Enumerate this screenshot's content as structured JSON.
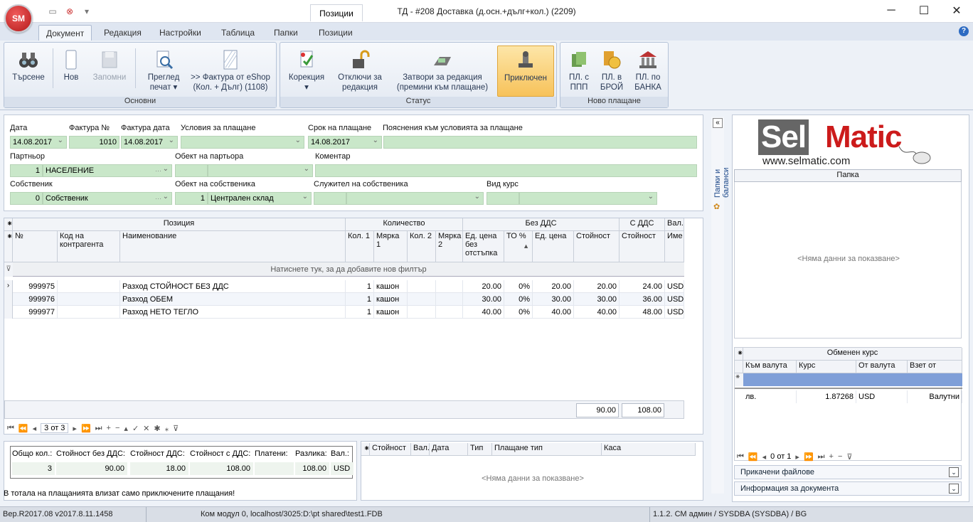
{
  "app": {
    "logo": "SM",
    "window_title": "ТД - #208 Доставка (д.осн.+дълг+кол.) (2209)",
    "context_tab": "Позиции"
  },
  "tabs": [
    "Документ",
    "Редакция",
    "Настройки",
    "Таблица",
    "Папки",
    "Позиции"
  ],
  "ribbon": {
    "groups": [
      {
        "caption": "Основни"
      },
      {
        "caption": "Статус"
      },
      {
        "caption": "Ново плащане"
      }
    ],
    "buttons": [
      {
        "l1": "Търсене",
        "l2": "",
        "icon": "binoculars-icon"
      },
      {
        "l1": "Нов",
        "l2": "",
        "icon": "new-document-icon"
      },
      {
        "l1": "Запомни",
        "l2": "",
        "icon": "save-icon"
      },
      {
        "l1": "Преглед",
        "l2": "печат ▾",
        "icon": "print-preview-icon"
      },
      {
        "l1": ">> Фактура от eShop",
        "l2": "(Кол. + Дълг) (1108)",
        "icon": "invoice-icon"
      },
      {
        "l1": "Корекция",
        "l2": "▾",
        "icon": "correction-icon"
      },
      {
        "l1": "Отключи за",
        "l2": "редакция",
        "icon": "unlock-icon"
      },
      {
        "l1": "Затвори за редакция",
        "l2": "(премини към плащане)",
        "icon": "cash-register-icon"
      },
      {
        "l1": "Приключен",
        "l2": "",
        "icon": "stamp-icon"
      },
      {
        "l1": "ПЛ. с",
        "l2": "ППП",
        "icon": "money-icon"
      },
      {
        "l1": "ПЛ. в",
        "l2": "БРОЙ",
        "icon": "coins-icon"
      },
      {
        "l1": "ПЛ. по",
        "l2": "БАНКА",
        "icon": "bank-icon"
      }
    ]
  },
  "form": {
    "labels": {
      "date": "Дата",
      "invoice_no": "Фактура №",
      "invoice_date": "Фактура дата",
      "pay_terms": "Условия за плащане",
      "due": "Срок на плащане",
      "terms_note": "Пояснения към условията за плащане",
      "partner": "Партньор",
      "partner_obj": "Обект на партьора",
      "comment": "Коментар",
      "owner": "Собственик",
      "owner_obj": "Обект на собственика",
      "employee": "Служител на собственика",
      "rate_type": "Вид курс"
    },
    "values": {
      "date": "14.08.2017",
      "invoice_no": "1010",
      "invoice_date": "14.08.2017",
      "due": "14.08.2017",
      "partner_code": "1",
      "partner_name": "НАСЕЛЕНИЕ",
      "owner_code": "0",
      "owner_name": "Собственик",
      "owner_obj_code": "1",
      "owner_obj_name": "Централен склад"
    }
  },
  "grid": {
    "bands": [
      "Позиция",
      "Количество",
      "Без ДДС",
      "С ДДС",
      "Вал."
    ],
    "columns": [
      "№",
      "Код на контрагента",
      "Наименование",
      "Кол. 1",
      "Мярка 1",
      "Кол. 2",
      "Мярка 2",
      "Ед. цена без отстъпка",
      "ТО %",
      "Ед. цена",
      "Стойност",
      "Стойност",
      "Име"
    ],
    "filter_hint": "Натиснете тук, за да добавите нов филтър",
    "rows": [
      {
        "no": "999975",
        "code": "",
        "name": "Разход СТОЙНОСТ БЕЗ ДДС",
        "q1": "1",
        "m1": "кашон",
        "q2": "",
        "m2": "",
        "price0": "20.00",
        "disc": "0%",
        "price": "20.00",
        "value": "20.00",
        "vat_value": "24.00",
        "cur": "USD"
      },
      {
        "no": "999976",
        "code": "",
        "name": "Разход ОБЕМ",
        "q1": "1",
        "m1": "кашон",
        "q2": "",
        "m2": "",
        "price0": "30.00",
        "disc": "0%",
        "price": "30.00",
        "value": "30.00",
        "vat_value": "36.00",
        "cur": "USD"
      },
      {
        "no": "999977",
        "code": "",
        "name": "Разход НЕТО ТЕГЛО",
        "q1": "1",
        "m1": "кашон",
        "q2": "",
        "m2": "",
        "price0": "40.00",
        "disc": "0%",
        "price": "40.00",
        "value": "40.00",
        "vat_value": "48.00",
        "cur": "USD"
      }
    ],
    "footer": {
      "value_total": "90.00",
      "vat_total": "108.00"
    },
    "nav": {
      "pos": "3 от 3"
    }
  },
  "totals": {
    "headers": [
      "Общо кол.:",
      "Стойност без ДДС:",
      "Стойност ДДС:",
      "Стойност с ДДС:",
      "Платени:",
      "Разлика:",
      "Вал.:"
    ],
    "values": [
      "3",
      "90.00",
      "18.00",
      "108.00",
      "",
      "108.00",
      "USD"
    ],
    "note": "В тотала на плащанията влизат само приключените плащания!"
  },
  "payments": {
    "headers": [
      "Стойност",
      "Вал.",
      "Дата",
      "Тип",
      "Плащане тип",
      "Каса"
    ],
    "empty": "<Няма данни за показване>"
  },
  "right": {
    "collapse_tab": "Папки и баланси",
    "logo_text_a": "Sel",
    "logo_text_b": "Matic",
    "logo_url": "www.selmatic.com",
    "folder_header": "Папка",
    "folder_empty": "<Няма данни за показване>",
    "rate_band": "Обменен курс",
    "rate_cols": [
      "Към валута",
      "Курс",
      "От валута",
      "Взет от"
    ],
    "rate_row": {
      "to": "лв.",
      "rate": "1.87268",
      "from": "USD",
      "source": "Валутни"
    },
    "nav": {
      "pos": "0 от 1"
    },
    "attached": "Прикачени файлове",
    "docinfo": "Информация за документа"
  },
  "status": {
    "version": "Вер.R2017.08 v2017.8.11.1458",
    "db": "Ком модул 0, localhost/3025:D:\\pt shared\\test1.FDB",
    "user": "1.1.2. СМ админ / SYSDBA (SYSDBA) / BG"
  }
}
